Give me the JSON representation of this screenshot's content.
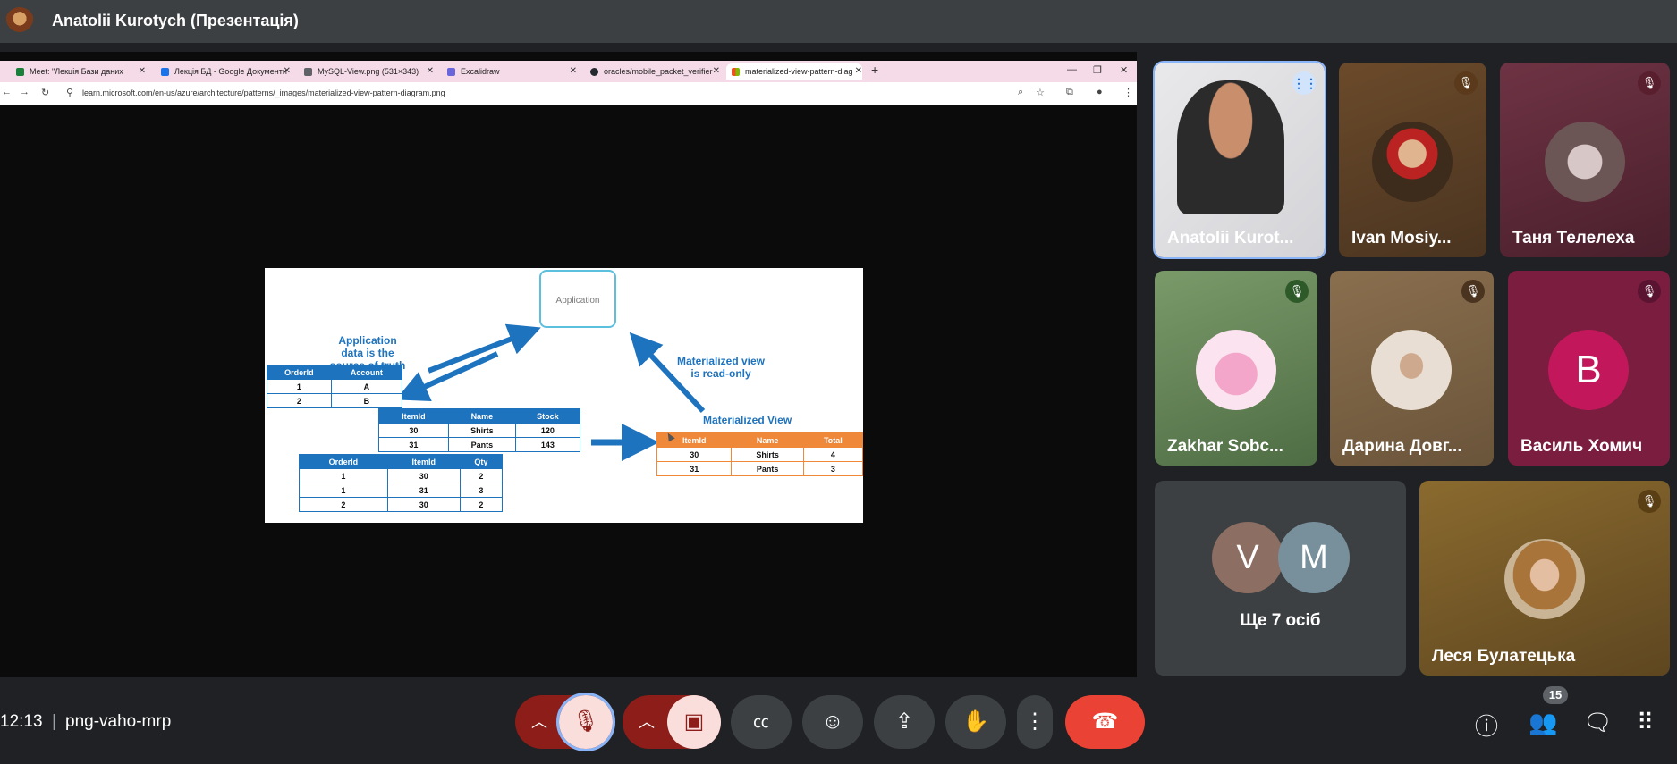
{
  "top_bar": {
    "title": "Anatolii Kurotych (Презентація)",
    "presenter_icon": "presenter-avatar"
  },
  "browser": {
    "tabs": [
      {
        "label": "Meet: \"Лекція Бази даних",
        "icon_color": "#188038",
        "active": false
      },
      {
        "label": "Лекція БД - Google Документи",
        "icon_color": "#1a73e8",
        "active": false
      },
      {
        "label": "MySQL-View.png (531×343)",
        "icon_color": "#5f6368",
        "active": false
      },
      {
        "label": "Excalidraw",
        "icon_color": "#6965db",
        "active": false
      },
      {
        "label": "oracles/mobile_packet_verifier",
        "icon_color": "#24292f",
        "active": false
      },
      {
        "label": "materialized-view-pattern-diag",
        "icon_color": "#f25022",
        "active": true
      }
    ],
    "url": "learn.microsoft.com/en-us/azure/architecture/patterns/_images/materialized-view-pattern-diagram.png"
  },
  "diagram": {
    "application_label": "Application",
    "source_caption": [
      "Application",
      "data is the",
      "source of truth"
    ],
    "readonly_caption": [
      "Materialized view",
      "is read-only"
    ],
    "mv_title": "Materialized View",
    "orders": {
      "headers": [
        "OrderId",
        "Account"
      ],
      "rows": [
        [
          "1",
          "A"
        ],
        [
          "2",
          "B"
        ]
      ]
    },
    "items": {
      "headers": [
        "ItemId",
        "Name",
        "Stock"
      ],
      "rows": [
        [
          "30",
          "Shirts",
          "120"
        ],
        [
          "31",
          "Pants",
          "143"
        ]
      ]
    },
    "order_items": {
      "headers": [
        "OrderId",
        "ItemId",
        "Qty"
      ],
      "rows": [
        [
          "1",
          "30",
          "2"
        ],
        [
          "1",
          "31",
          "3"
        ],
        [
          "2",
          "30",
          "2"
        ]
      ]
    },
    "materialized": {
      "headers": [
        "ItemId",
        "Name",
        "Total"
      ],
      "rows": [
        [
          "30",
          "Shirts",
          "4"
        ],
        [
          "31",
          "Pants",
          "3"
        ]
      ]
    }
  },
  "participants": [
    {
      "name": "Anatolii Kurot...",
      "status": "speaking"
    },
    {
      "name": "Ivan Mosiy...",
      "status": "muted"
    },
    {
      "name": "Таня Телелеха",
      "status": "muted"
    },
    {
      "name": "Zakhar Sobc...",
      "status": "muted"
    },
    {
      "name": "Дарина Довг...",
      "status": "muted"
    },
    {
      "name": "Василь Хомич",
      "status": "muted",
      "initial": "В"
    },
    {
      "name": "Ще 7 осіб",
      "initials": [
        "V",
        "M"
      ]
    },
    {
      "name": "Леся Булатецька",
      "status": "muted"
    }
  ],
  "bottom_bar": {
    "time": "12:13",
    "separator": "|",
    "meeting_code": "png-vaho-mrp",
    "people_count": "15"
  },
  "colors": {
    "end_call": "#ea4335",
    "muted_red": "#8c1d18",
    "diagram_blue": "#1e73be",
    "diagram_orange": "#f0883a"
  }
}
